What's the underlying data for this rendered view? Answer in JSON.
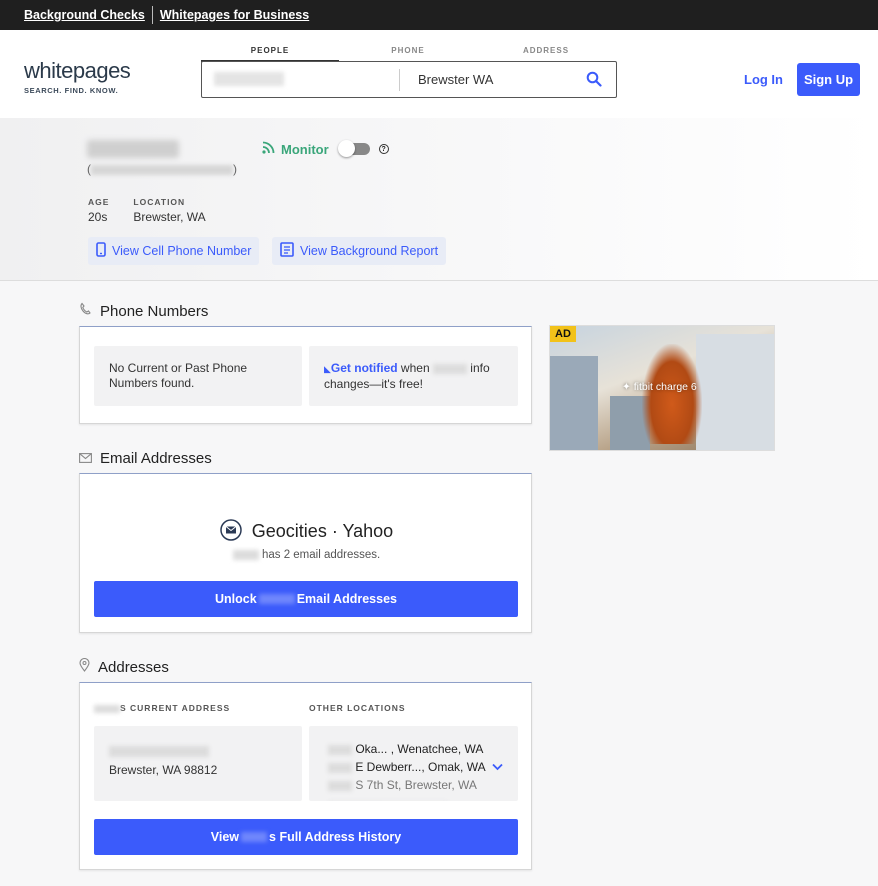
{
  "topbar": {
    "link1": "Background Checks",
    "link2": "Whitepages for Business"
  },
  "header": {
    "logo_word": "whitepages",
    "logo_tag": "SEARCH. FIND. KNOW.",
    "tabs": [
      "PEOPLE",
      "PHONE",
      "ADDRESS"
    ],
    "search_location": "Brewster WA",
    "login": "Log In",
    "signup": "Sign Up"
  },
  "profile": {
    "aka_open": "(",
    "aka_close": ")",
    "monitor_label": "Monitor",
    "help": "?",
    "age_label": "AGE",
    "age_value": "20s",
    "location_label": "LOCATION",
    "location_value": "Brewster, WA",
    "btn_cell": "View Cell Phone Number",
    "btn_report": "View Background Report"
  },
  "phones": {
    "title": "Phone Numbers",
    "none_text": "No Current or Past Phone Numbers found.",
    "notify_link": "Get notified",
    "notify_when": " when ",
    "notify_info": " info changes—it's free!"
  },
  "emails": {
    "title": "Email Addresses",
    "providers": "Geocities · Yahoo",
    "count_text": " has 2 email addresses.",
    "unlock_pre": "Unlock ",
    "unlock_post": " Email Addresses"
  },
  "addresses": {
    "title": "Addresses",
    "current_label": "S CURRENT ADDRESS",
    "current_city": "Brewster, WA 98812",
    "other_label": "OTHER LOCATIONS",
    "others": [
      "Oka... , Wenatchee, WA",
      "E Dewberr..., Omak, WA",
      "S 7th St, Brewster, WA"
    ],
    "history_pre": "View ",
    "history_post": "s Full Address History"
  },
  "ad": {
    "badge": "AD",
    "brand": "✦ fitbit charge 6"
  },
  "colors": {
    "accent": "#3b5bfb",
    "monitor": "#3aa67a",
    "ad_badge": "#f2c21a"
  }
}
